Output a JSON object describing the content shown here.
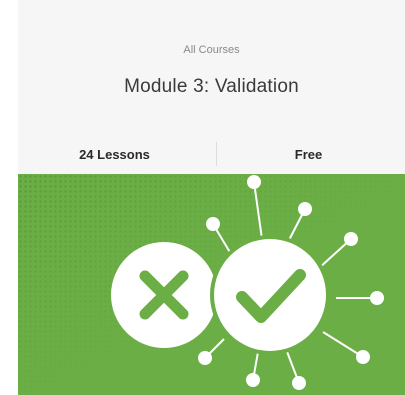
{
  "course": {
    "breadcrumb": "All Courses",
    "title": "Module 3: Validation"
  },
  "stats": {
    "lessons": "24 Lessons",
    "price": "Free"
  },
  "banner": {
    "background": "#6bae45",
    "accent_dark": "#5a9a39",
    "foreground": "#ffffff",
    "icons": [
      "cross-icon",
      "checkmark-icon"
    ]
  }
}
